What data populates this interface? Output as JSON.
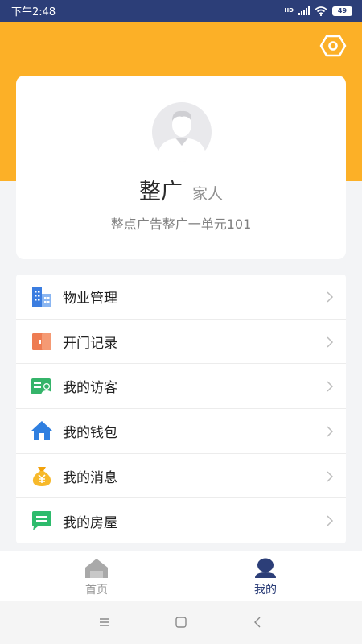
{
  "status_bar": {
    "time": "下午2:48",
    "network": "HD",
    "battery": "49"
  },
  "header": {
    "settings_icon": "hexagon-settings-icon",
    "background_color": "#fcb027"
  },
  "profile": {
    "avatar_icon": "default-user-avatar-icon",
    "name": "整广",
    "role": "家人",
    "address": "整点广告整广一单元101"
  },
  "menu": {
    "items": [
      {
        "label": "物业管理",
        "icon": "building-icon"
      },
      {
        "label": "开门记录",
        "icon": "door-icon"
      },
      {
        "label": "我的访客",
        "icon": "visitor-card-icon"
      },
      {
        "label": "我的钱包",
        "icon": "house-wallet-icon"
      },
      {
        "label": "我的消息",
        "icon": "money-bag-icon"
      },
      {
        "label": "我的房屋",
        "icon": "chat-bubble-icon"
      }
    ]
  },
  "tab_bar": {
    "home_label": "首页",
    "mine_label": "我的",
    "active": "mine",
    "accent_color": "#2c3e78"
  }
}
